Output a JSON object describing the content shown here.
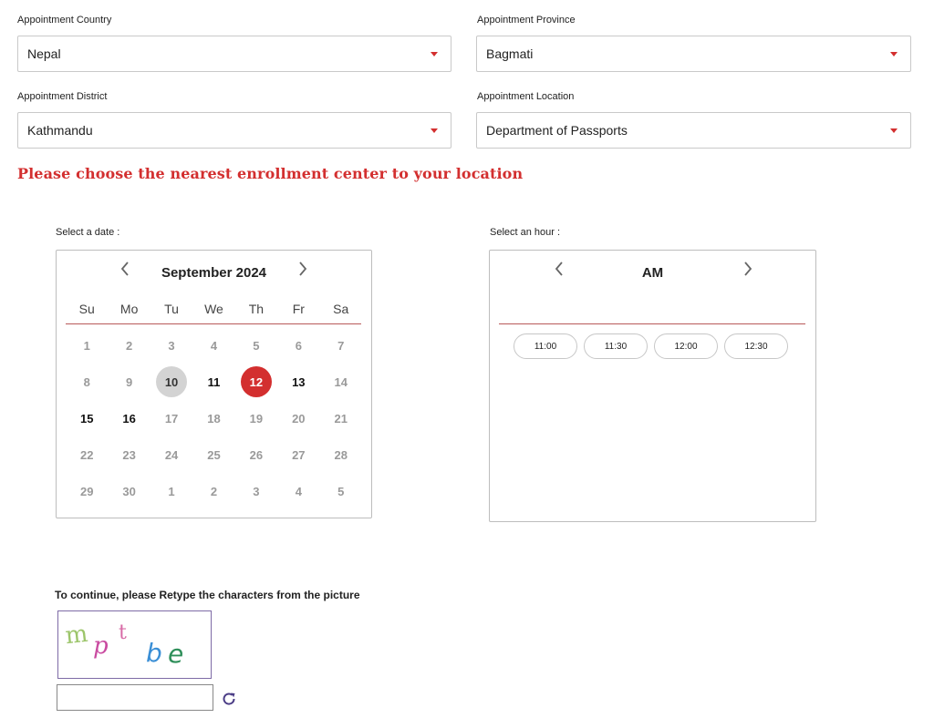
{
  "form": {
    "country": {
      "label": "Appointment Country",
      "value": "Nepal"
    },
    "province": {
      "label": "Appointment Province",
      "value": "Bagmati"
    },
    "district": {
      "label": "Appointment District",
      "value": "Kathmandu"
    },
    "location": {
      "label": "Appointment Location",
      "value": "Department of Passports"
    },
    "notice": "Please choose the nearest enrollment center to your location"
  },
  "date_picker": {
    "label": "Select a date :",
    "month_title": "September 2024",
    "days_of_week": [
      "Su",
      "Mo",
      "Tu",
      "We",
      "Th",
      "Fr",
      "Sa"
    ],
    "weeks": [
      [
        {
          "d": "1",
          "s": "off"
        },
        {
          "d": "2",
          "s": "off"
        },
        {
          "d": "3",
          "s": "off"
        },
        {
          "d": "4",
          "s": "off"
        },
        {
          "d": "5",
          "s": "off"
        },
        {
          "d": "6",
          "s": "off"
        },
        {
          "d": "7",
          "s": "off"
        }
      ],
      [
        {
          "d": "8",
          "s": "off"
        },
        {
          "d": "9",
          "s": "off"
        },
        {
          "d": "10",
          "s": "today"
        },
        {
          "d": "11",
          "s": "avail"
        },
        {
          "d": "12",
          "s": "sel"
        },
        {
          "d": "13",
          "s": "avail"
        },
        {
          "d": "14",
          "s": "off"
        }
      ],
      [
        {
          "d": "15",
          "s": "avail"
        },
        {
          "d": "16",
          "s": "avail"
        },
        {
          "d": "17",
          "s": "off"
        },
        {
          "d": "18",
          "s": "off"
        },
        {
          "d": "19",
          "s": "off"
        },
        {
          "d": "20",
          "s": "off"
        },
        {
          "d": "21",
          "s": "off"
        }
      ],
      [
        {
          "d": "22",
          "s": "off"
        },
        {
          "d": "23",
          "s": "off"
        },
        {
          "d": "24",
          "s": "off"
        },
        {
          "d": "25",
          "s": "off"
        },
        {
          "d": "26",
          "s": "off"
        },
        {
          "d": "27",
          "s": "off"
        },
        {
          "d": "28",
          "s": "off"
        }
      ],
      [
        {
          "d": "29",
          "s": "off"
        },
        {
          "d": "30",
          "s": "off"
        },
        {
          "d": "1",
          "s": "off"
        },
        {
          "d": "2",
          "s": "off"
        },
        {
          "d": "3",
          "s": "off"
        },
        {
          "d": "4",
          "s": "off"
        },
        {
          "d": "5",
          "s": "off"
        }
      ]
    ],
    "selected_color": "#d32f2f",
    "today_color": "#d3d3d3"
  },
  "hour_picker": {
    "label": "Select an hour :",
    "period": "AM",
    "slots": [
      "11:00",
      "11:30",
      "12:00",
      "12:30"
    ]
  },
  "captcha": {
    "prompt": "To continue, please Retype the characters from the picture",
    "text": "mptbe",
    "input_value": ""
  }
}
